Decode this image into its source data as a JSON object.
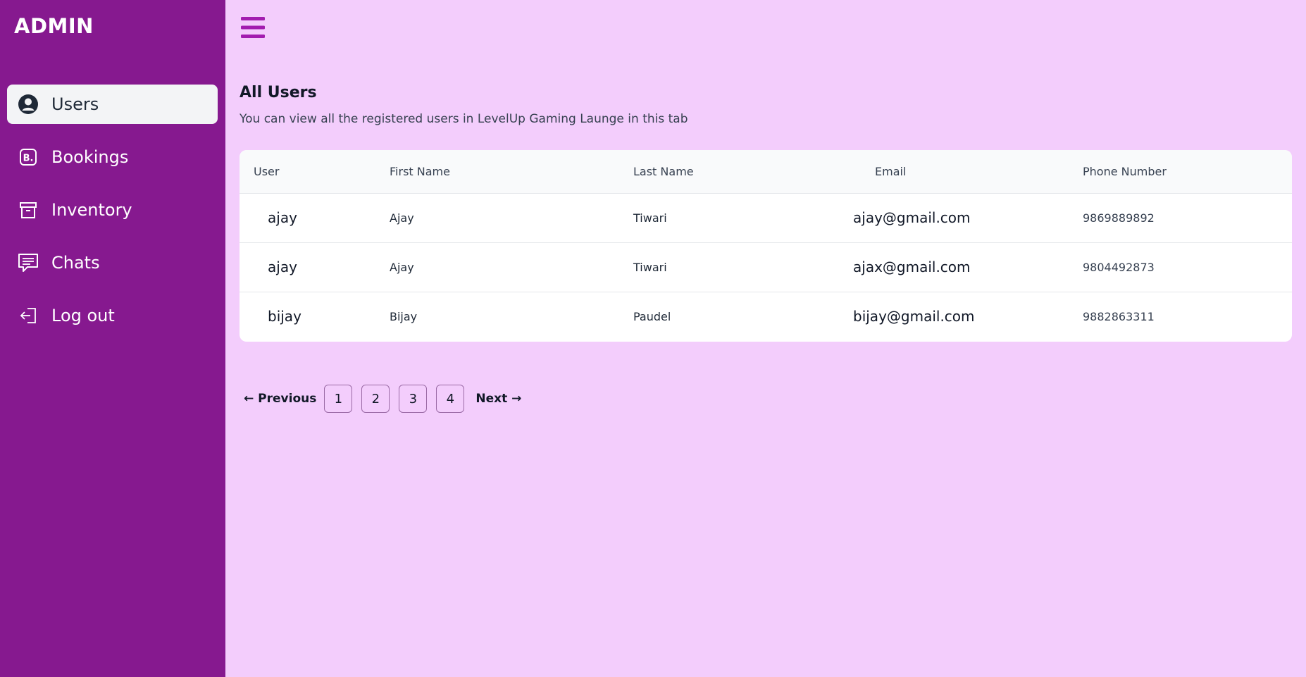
{
  "sidebar": {
    "brand": "ADMIN",
    "items": [
      {
        "label": "Users",
        "icon": "user-circle-icon"
      },
      {
        "label": "Bookings",
        "icon": "bookings-icon"
      },
      {
        "label": "Inventory",
        "icon": "archive-icon"
      },
      {
        "label": "Chats",
        "icon": "chat-icon"
      },
      {
        "label": "Log out",
        "icon": "logout-icon"
      }
    ],
    "active_item": "Users"
  },
  "header": {
    "menu_icon": "hamburger-icon"
  },
  "main": {
    "title": "All Users",
    "subtitle": "You can view all the registered users in LevelUp Gaming Launge in this tab"
  },
  "table": {
    "columns": [
      "User",
      "First Name",
      "Last Name",
      "Email",
      "Phone Number"
    ],
    "rows": [
      {
        "user": "ajay",
        "first_name": "Ajay",
        "last_name": "Tiwari",
        "email": "ajay@gmail.com",
        "phone": "9869889892"
      },
      {
        "user": "ajay",
        "first_name": "Ajay",
        "last_name": "Tiwari",
        "email": "ajax@gmail.com",
        "phone": "9804492873"
      },
      {
        "user": "bijay",
        "first_name": "Bijay",
        "last_name": "Paudel",
        "email": "bijay@gmail.com",
        "phone": "9882863311"
      }
    ]
  },
  "pagination": {
    "previous": "← Previous",
    "pages": [
      "1",
      "2",
      "3",
      "4"
    ],
    "next": "Next →"
  },
  "colors": {
    "sidebar_bg": "#86198f",
    "main_bg": "#f3cdfc",
    "accent": "#a21caf"
  }
}
